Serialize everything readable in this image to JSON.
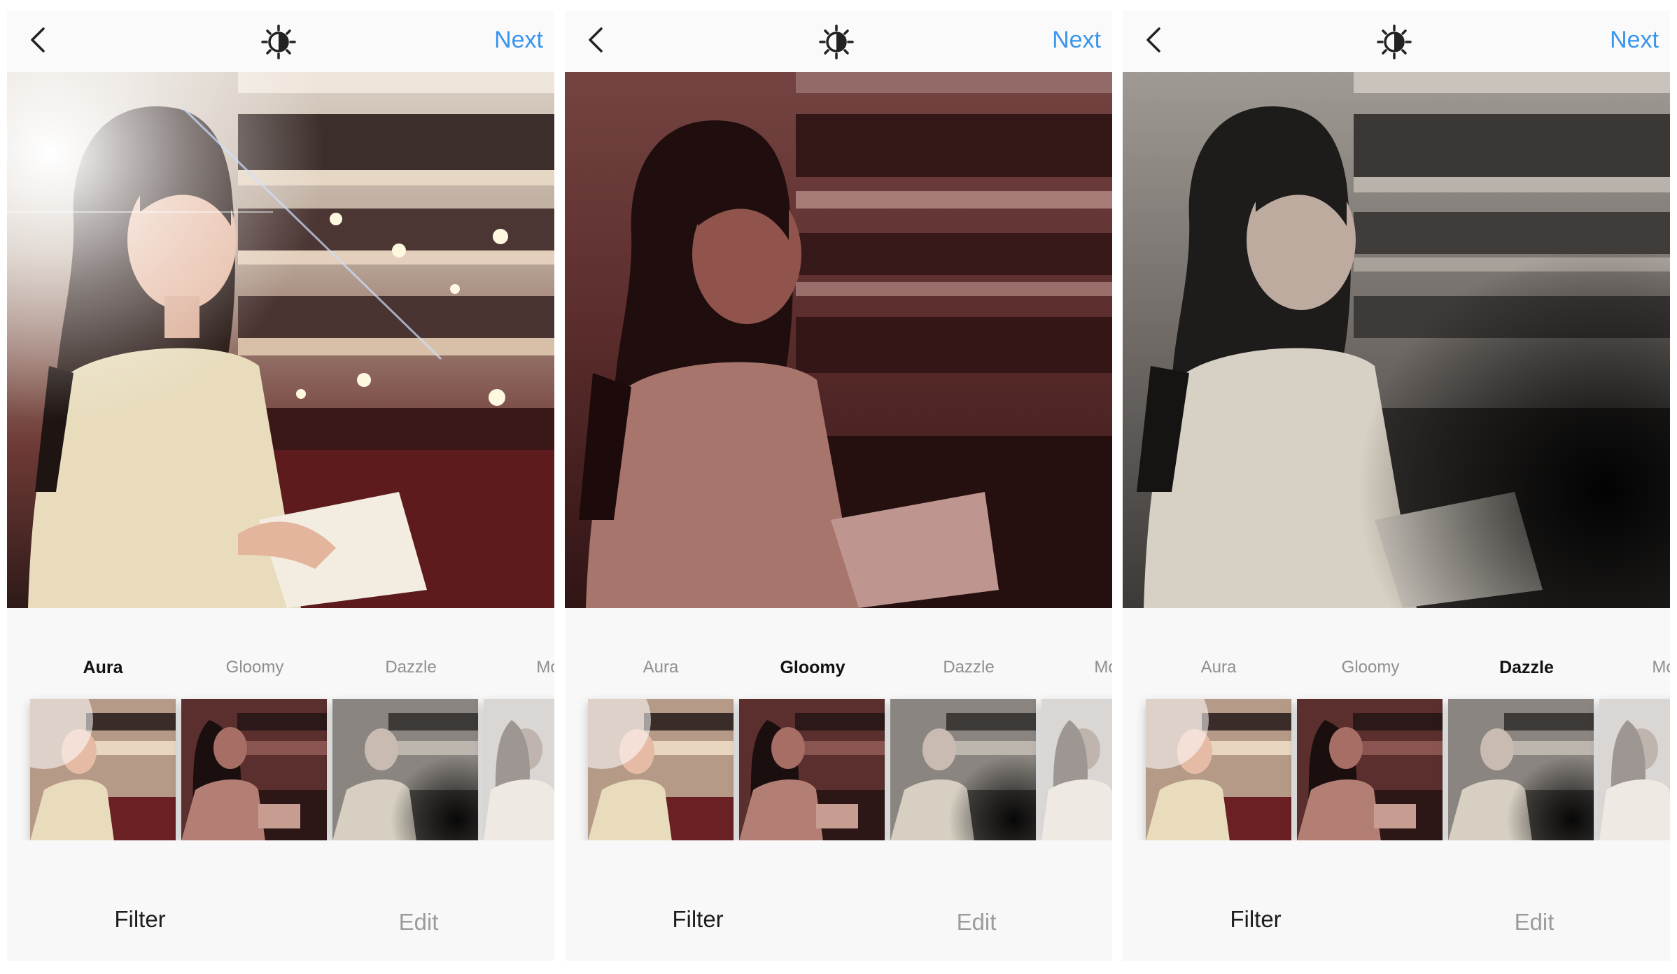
{
  "panels": [
    {
      "next_label": "Next",
      "filters": [
        "Aura",
        "Gloomy",
        "Dazzle",
        "Mo"
      ],
      "selected_filter": "Aura",
      "tabs": {
        "filter": "Filter",
        "edit": "Edit"
      }
    },
    {
      "next_label": "Next",
      "filters": [
        "Aura",
        "Gloomy",
        "Dazzle",
        "Mo"
      ],
      "selected_filter": "Gloomy",
      "tabs": {
        "filter": "Filter",
        "edit": "Edit"
      }
    },
    {
      "next_label": "Next",
      "filters": [
        "Aura",
        "Gloomy",
        "Dazzle",
        "Mo"
      ],
      "selected_filter": "Dazzle",
      "tabs": {
        "filter": "Filter",
        "edit": "Edit"
      }
    }
  ],
  "icons": {
    "back": "chevron-left-icon",
    "adjust": "brightness-contrast-icon"
  },
  "colors": {
    "next": "#3a95ec",
    "active_label": "#111111",
    "inactive_label": "#8f8f8f"
  }
}
